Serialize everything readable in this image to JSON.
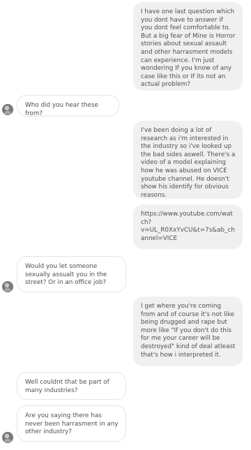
{
  "conversation": {
    "messages": [
      {
        "side": "sent",
        "text": "I have one last question which you dont have to answer if you dont feel comfortable to. But a big fear of Mine is Horror stories about sexual assault and other harrasment models can experience. I'm just wondering If you know of any case like this or If its not an actual problem?"
      },
      {
        "side": "recv",
        "text": "Who did you hear these from?"
      },
      {
        "side": "sent",
        "text": "I've been doing a lot of research as i'm interested in the industry so i've looked up the bad sides aswell. There's a video of a model explaining how he was abused on VICE youtube channel. He doesn't show his identify for obvious reasons."
      },
      {
        "side": "sent",
        "text": "https://www.youtube.com/watch?v=UL_R0XxYvCU&t=7s&ab_channel=VICE"
      },
      {
        "side": "recv",
        "text": "Would you let someone sexually assualt you in the street? Or in an office job?"
      },
      {
        "side": "sent",
        "text": "I get where you're coming from and of course it's not like being drugged and rape but more like \"If you don't do this for me your career will be destroyed\" kind of deal atleast that's how i interpreted it."
      },
      {
        "side": "recv",
        "text": "Well couldnt that be part of many industries?"
      },
      {
        "side": "recv",
        "text": "Are you saying there has never been harrasment in any other industry?"
      }
    ]
  },
  "avatars": [
    {
      "icon": "contact-avatar-icon"
    },
    {
      "icon": "contact-avatar-icon"
    },
    {
      "icon": "contact-avatar-icon"
    }
  ]
}
